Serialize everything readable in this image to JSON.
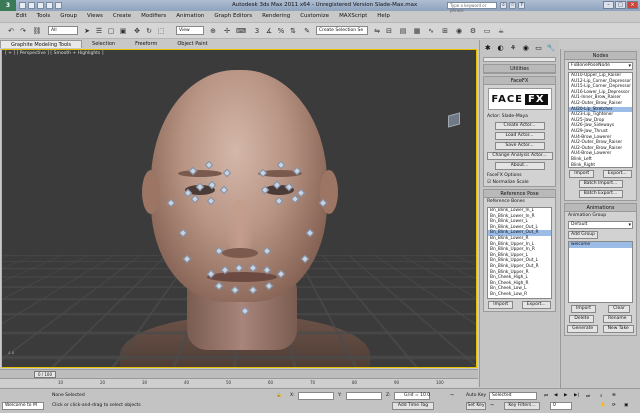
{
  "window": {
    "title": "Autodesk 3ds Max 2011 x64    -  Unregistered Version    Slade-Max.max",
    "search_placeholder": "Type a keyword or phrase"
  },
  "menu": [
    "Edit",
    "Tools",
    "Group",
    "Views",
    "Create",
    "Modifiers",
    "Animation",
    "Graph Editors",
    "Rendering",
    "Customize",
    "MAXScript",
    "Help"
  ],
  "toolbar": {
    "selection_filter": "All",
    "view_dropdown": "View",
    "named_selection": "Create Selection Se"
  },
  "ribbon_tabs": [
    "Graphite Modeling Tools",
    "Selection",
    "Freeform",
    "Object Paint"
  ],
  "viewport": {
    "label": "[ + ] [ Perspective ] [ Smooth + Highlights ]"
  },
  "utilities": {
    "header": "Utilities",
    "facefx_header": "FaceFX",
    "logo_left": "FACE",
    "logo_right": "FX",
    "actor_label": "Actor: Slade-Maya",
    "buttons": [
      "Create Actor...",
      "Load Actor...",
      "Save Actor...",
      "Change Analysis Actor...",
      "About..."
    ],
    "options_label": "FaceFX Options",
    "normalize_label": "Normalize Scale"
  },
  "reference_pose": {
    "header": "Reference Pose",
    "list_label": "Reference Bones",
    "items": [
      "Bn_Blink_Lower_In_L",
      "Bn_Blink_Lower_In_R",
      "Bn_Blink_Lower_L",
      "Bn_Blink_Lower_Out_L",
      "Bn_Blink_Lower_Out_R",
      "Bn_Blink_Lower_R",
      "Bn_Blink_Upper_In_L",
      "Bn_Blink_Upper_In_R",
      "Bn_Blink_Upper_L",
      "Bn_Blink_Upper_Out_L",
      "Bn_Blink_Upper_Out_R",
      "Bn_Blink_Upper_R",
      "Bn_Cheek_High_L",
      "Bn_Cheek_High_R",
      "Bn_Cheek_Low_L",
      "Bn_Cheek_Low_R"
    ],
    "selected_index": 4,
    "import_label": "Import",
    "export_label": "Export..."
  },
  "nodes": {
    "header": "Nodes",
    "combo_value": "FxBonePoseNode",
    "items": [
      "AU10-Upper_Lip_Raiser",
      "AU12-Lip_Corner_Depressor",
      "AU15-Lip_Corner_Depressor",
      "AU16-Lower_Lip_Depressor",
      "AU1-Inner_Brow_Raiser",
      "AU2-Outer_Brow_Raiser",
      "AU20-Lip_Stretcher",
      "AU23-Lip_Tightener",
      "AU25-Jaw_Drop",
      "AU26-Jaw_Sideways",
      "AU29-Jaw_Thrust",
      "AU4-Brow_Lowerer",
      "AU2-Outer_Brow_Raiser",
      "AU2-Outer_Brow_Raiser",
      "AU4-Brow_Lowerer",
      "Blink_Left",
      "Blink_Right"
    ],
    "selected_index": 6,
    "import_label": "Import",
    "export_label": "Export...",
    "batch_import_label": "Batch Import...",
    "batch_export_label": "Batch Export..."
  },
  "animations": {
    "header": "Animations",
    "group_label": "Animation Group",
    "group_value": "Default",
    "add_group_label": "Add Group",
    "items": [
      "welcome"
    ],
    "import_label": "Import",
    "clear_label": "Clear",
    "delete_label": "Delete",
    "rename_label": "Rename",
    "generate_label": "Generate",
    "new_take_label": "New Take"
  },
  "timeline": {
    "frame": "0 / 100",
    "ticks": [
      "10",
      "20",
      "30",
      "40",
      "50",
      "60",
      "70",
      "80",
      "90",
      "100"
    ]
  },
  "status": {
    "script_value": "Welcome to M",
    "selection_text": "None Selected",
    "hint_text": "Click or click-and-drag to select objects",
    "x_label": "X:",
    "y_label": "Y:",
    "z_label": "Z:",
    "grid_text": "Grid = 10.0",
    "auto_key": "Auto Key",
    "set_key": "Set Key",
    "selected_value": "Selected",
    "key_filters": "Key Filters...",
    "add_time_tag": "Add Time Tag",
    "frame_value": "0"
  }
}
